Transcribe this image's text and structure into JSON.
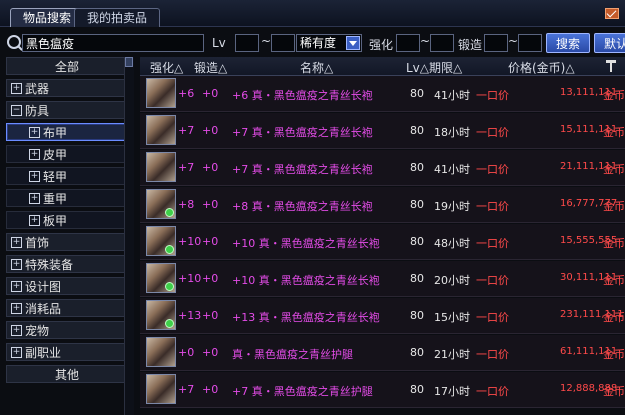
{
  "tabs": [
    {
      "label": "物品搜索",
      "active": true
    },
    {
      "label": "我的拍卖品",
      "active": false
    }
  ],
  "search": {
    "item_name": "黑色瘟疫",
    "lv_label": "Lv",
    "tilde": "~",
    "rarity_value": "稀有度",
    "qianghua_label": "强化",
    "duanzao_label": "锻造",
    "search_button": "搜索",
    "reset_button": "默认"
  },
  "categories": [
    {
      "label": "全部",
      "type": "center"
    },
    {
      "label": "武器",
      "type": "group"
    },
    {
      "label": "防具",
      "type": "group-open"
    },
    {
      "label": "布甲",
      "type": "sub",
      "selected": true
    },
    {
      "label": "皮甲",
      "type": "sub"
    },
    {
      "label": "轻甲",
      "type": "sub"
    },
    {
      "label": "重甲",
      "type": "sub"
    },
    {
      "label": "板甲",
      "type": "sub"
    },
    {
      "label": "首饰",
      "type": "group"
    },
    {
      "label": "特殊装备",
      "type": "group"
    },
    {
      "label": "设计图",
      "type": "group"
    },
    {
      "label": "消耗品",
      "type": "group"
    },
    {
      "label": "宠物",
      "type": "group"
    },
    {
      "label": "副职业",
      "type": "group"
    },
    {
      "label": "其他",
      "type": "center"
    }
  ],
  "columns": {
    "qianghua": "强化△",
    "duanzao": "锻造△",
    "name": "名称△",
    "lv_time": "Lv△期限△",
    "price": "价格(金币)△"
  },
  "rows": [
    {
      "q": "+6",
      "d": "+0",
      "name": "+6 真・黑色瘟疫之青丝长袍",
      "lv": "80",
      "time": "41小时",
      "price_type": "一口价",
      "price": "13,111,111",
      "currency": "金币",
      "gem": false
    },
    {
      "q": "+7",
      "d": "+0",
      "name": "+7 真・黑色瘟疫之青丝长袍",
      "lv": "80",
      "time": "18小时",
      "price_type": "一口价",
      "price": "15,111,111",
      "currency": "金币",
      "gem": false
    },
    {
      "q": "+7",
      "d": "+0",
      "name": "+7 真・黑色瘟疫之青丝长袍",
      "lv": "80",
      "time": "41小时",
      "price_type": "一口价",
      "price": "21,111,111",
      "currency": "金币",
      "gem": false
    },
    {
      "q": "+8",
      "d": "+0",
      "name": "+8 真・黑色瘟疫之青丝长袍",
      "lv": "80",
      "time": "19小时",
      "price_type": "一口价",
      "price": "16,777,777",
      "currency": "金币",
      "gem": true
    },
    {
      "q": "+10",
      "d": "+0",
      "name": "+10 真・黑色瘟疫之青丝长袍",
      "lv": "80",
      "time": "48小时",
      "price_type": "一口价",
      "price": "15,555,555",
      "currency": "金币",
      "gem": true
    },
    {
      "q": "+10",
      "d": "+0",
      "name": "+10 真・黑色瘟疫之青丝长袍",
      "lv": "80",
      "time": "20小时",
      "price_type": "一口价",
      "price": "30,111,111",
      "currency": "金币",
      "gem": true
    },
    {
      "q": "+13",
      "d": "+0",
      "name": "+13 真・黑色瘟疫之青丝长袍",
      "lv": "80",
      "time": "15小时",
      "price_type": "一口价",
      "price": "231,111,111",
      "currency": "金币",
      "gem": true
    },
    {
      "q": "+0",
      "d": "+0",
      "name": "真・黑色瘟疫之青丝护腿",
      "lv": "80",
      "time": "21小时",
      "price_type": "一口价",
      "price": "61,111,111",
      "currency": "金币",
      "gem": false
    },
    {
      "q": "+7",
      "d": "+0",
      "name": "+7 真・黑色瘟疫之青丝护腿",
      "lv": "80",
      "time": "17小时",
      "price_type": "一口价",
      "price": "12,888,888",
      "currency": "金币",
      "gem": false
    }
  ]
}
